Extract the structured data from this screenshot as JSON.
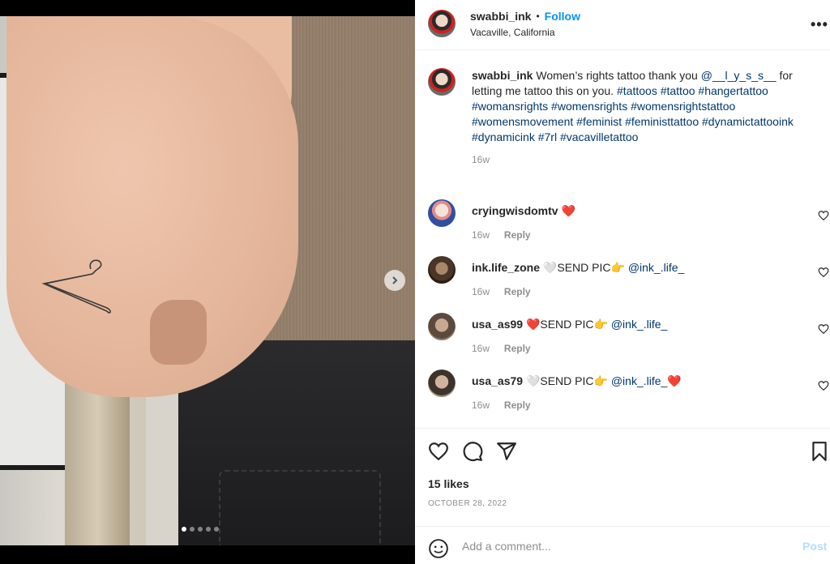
{
  "post": {
    "username": "swabbi_ink",
    "separator": "•",
    "follow_label": "Follow",
    "location": "Vacaville, California",
    "more_label": "•••",
    "caption_prefix": "Women’s rights tattoo thank you",
    "caption_mention": "@__l_y_s_s__",
    "caption_mid": "for letting me tattoo this on you.",
    "caption_tags": "#tattoos #tattoo #hangertattoo #womansrights #womensrights #womensrightstattoo #womensmovement #feminist #feministtattoo #dynamictattooink #dynamicink #7rl #vacavilletattoo",
    "caption_time": "16w"
  },
  "comments": [
    {
      "username": "cryingwisdomtv",
      "text": "❤️",
      "mention": "",
      "suffix": "",
      "time": "16w",
      "reply": "Reply"
    },
    {
      "username": "ink.life_zone",
      "text": "🤍SEND PIC👉",
      "mention": "@ink_.life_",
      "suffix": "",
      "time": "16w",
      "reply": "Reply"
    },
    {
      "username": "usa_as99",
      "text": "❤️SEND PIC👉",
      "mention": "@ink_.life_",
      "suffix": "",
      "time": "16w",
      "reply": "Reply"
    },
    {
      "username": "usa_as79",
      "text": "🤍SEND PIC👉",
      "mention": "@ink_.life_",
      "suffix": "❤️",
      "time": "16w",
      "reply": "Reply"
    }
  ],
  "actions": {
    "likes": "15 likes",
    "date": "OCTOBER 28, 2022"
  },
  "composer": {
    "placeholder": "Add a comment...",
    "post_label": "Post"
  },
  "carousel": {
    "dot_count": 5,
    "active_index": 0
  },
  "colors": {
    "link": "#00376b",
    "follow": "#0095f6",
    "muted": "#8e8e8e"
  },
  "icons": {
    "like": "heart-icon",
    "comment": "comment-icon",
    "share": "share-icon",
    "save": "bookmark-icon",
    "emoji": "emoji-icon",
    "next": "chevron-right-icon"
  }
}
